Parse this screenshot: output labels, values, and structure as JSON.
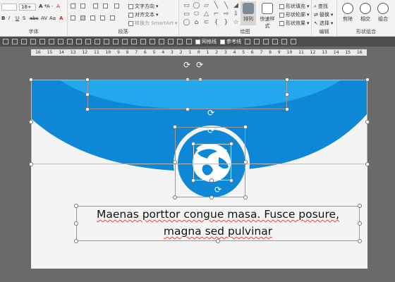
{
  "ribbon": {
    "font_group": {
      "label": "字体",
      "size_value": "18+",
      "style_buttons": [
        "B",
        "I",
        "U",
        "S",
        "abc",
        "AV",
        "Aa",
        "A"
      ]
    },
    "paragraph_group": {
      "label": "段落",
      "text_direction_label": "文字方向",
      "align_text_label": "对齐文本",
      "smartart_label": "转换为 SmartArt"
    },
    "drawing_group": {
      "label": "绘图",
      "arrange_label": "排列",
      "quick_styles_label": "快速样式",
      "shape_fill_label": "形状填充",
      "shape_outline_label": "形状轮廓",
      "shape_effects_label": "形状效果",
      "shapes": [
        "▭",
        "◯",
        "▱",
        "╲",
        "╲",
        "◢",
        "▭",
        "⬭",
        "△",
        "⌐",
        "⇨",
        "⇩",
        "◯",
        "⌂",
        "⊂",
        "{",
        "}",
        "☆"
      ]
    },
    "editing_group": {
      "label": "编辑",
      "find_label": "查找",
      "replace_label": "替换",
      "select_label": "选择"
    },
    "combine_group": {
      "label": "形状组合",
      "union_label": "剪除",
      "intersect_label": "相交",
      "combine_label": "组合"
    }
  },
  "view_toolbar": {
    "gridlines_label": "网格线",
    "guides_label": "参考线"
  },
  "ruler": {
    "ticks": [
      "16",
      "15",
      "14",
      "13",
      "12",
      "11",
      "10",
      "9",
      "8",
      "7",
      "6",
      "5",
      "4",
      "3",
      "2",
      "1",
      "0",
      "1",
      "2",
      "3",
      "4",
      "5",
      "6",
      "7",
      "8",
      "9",
      "10",
      "11",
      "12",
      "13",
      "14",
      "15",
      "16"
    ]
  },
  "slide": {
    "colors": {
      "band_dark": "#0e88d6",
      "band_light": "#23a8ee",
      "background": "#f4f4f4",
      "globe": "#ffffff"
    },
    "body_text_line1": "Maenas porttor congue masa. Fusce posure,",
    "body_text_line2": "magna sed pulvinar"
  }
}
